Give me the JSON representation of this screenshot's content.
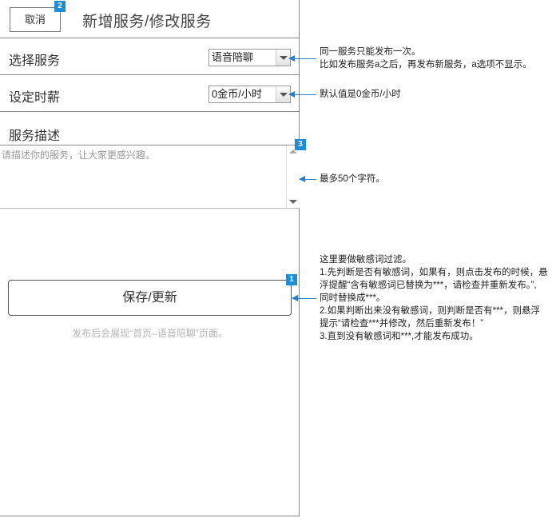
{
  "header": {
    "cancel_label": "取消",
    "title": "新增服务/修改服务"
  },
  "service_row": {
    "label": "选择服务",
    "selected": "语音陪聊"
  },
  "rate_row": {
    "label": "设定时薪",
    "selected": "0金币/小时"
  },
  "description": {
    "label": "服务描述",
    "placeholder": "请描述你的服务，让大家更感兴趣。"
  },
  "save": {
    "label": "保存/更新",
    "hint": "发布后会展现“首页–语音陪聊”页面。"
  },
  "badges": {
    "save": "1",
    "cancel": "2",
    "description": "3"
  },
  "annotations": {
    "service": [
      "同一服务只能发布一次。",
      "比如发布服务a之后，再发布新服务，a选项不显示。"
    ],
    "rate": [
      "默认值是0金币/小时"
    ],
    "description": [
      "最多50个字符。"
    ],
    "save": [
      "这里要做敏感词过滤。",
      "1.先判断是否有敏感词，如果有，则点击发布的时候，悬",
      "浮提醒“含有敏感词已替换为***，请检查并重新发布。”,",
      "同时替换成***。",
      "2.如果判断出来没有敏感词，则判断是否有***，则悬浮",
      "提示“请检查***并修改，然后重新发布！”",
      "3.直到没有敏感词和***,才能发布成功。"
    ]
  },
  "colors": {
    "badge": "#1f8ed6",
    "connector": "#2a7fc8"
  }
}
